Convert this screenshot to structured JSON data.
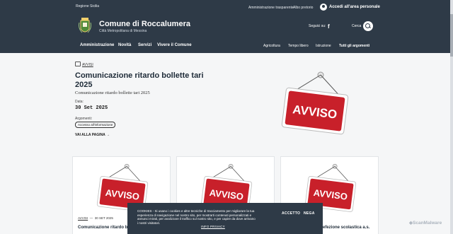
{
  "top_bar": {
    "region": "Regione Sicilia",
    "links": [
      "Amministrazione trasparente",
      "Albo pretorio"
    ],
    "login": "Accedi all'area personale"
  },
  "header": {
    "title": "Comune di Roccalumera",
    "subtitle": "Città Metropolitana di Messina",
    "follow_label": "Seguici su:",
    "search_label": "Cerca"
  },
  "nav": {
    "main": [
      "Amministrazione",
      "Novità",
      "Servizi",
      "Vivere il Comune"
    ],
    "secondary": [
      "Agricoltura",
      "Tempo libero",
      "Istruzione",
      "Tutti gli argomenti"
    ]
  },
  "article": {
    "category": "AVVISI",
    "title": "Comunicazione ritardo bollette tari 2025",
    "subtitle": "Comunicazione ritardo bollette tari 2025",
    "date_label": "Data:",
    "date": "30 Set 2025",
    "topics_label": "Argomenti:",
    "topic": "Accesso all'informazione",
    "read_more": "VAI ALLA PAGINA",
    "sign_text": "AVVISO"
  },
  "cards": [
    {
      "sign_text": "AVVISO",
      "category": "AVVISI",
      "date": "30 SET 2025",
      "title": "Comunicazione ritardo boll"
    },
    {
      "sign_text": "AVVISO"
    },
    {
      "sign_text": "AVVISO",
      "title": "efezione scolastica a.s."
    }
  ],
  "cookie": {
    "text": "COOKIES - Si usano i cookies e altre tecniche di tracciamento per migliorare la tua esperienza di navigazione nel nostro sito, per mostrarti contenuti personalizzati e annunci mirati, per analizzare il traffico sul nostro sito, e per capire da dove arrivano i nostri visitatori.",
    "info": "INFO PRIVACY",
    "accept": "ACCETTO",
    "deny": "NEGA"
  },
  "watermark": "ScanMalware",
  "colors": {
    "header": "#2e3a47",
    "sign_red": "#c8202a",
    "background": "#f5f6f7"
  }
}
